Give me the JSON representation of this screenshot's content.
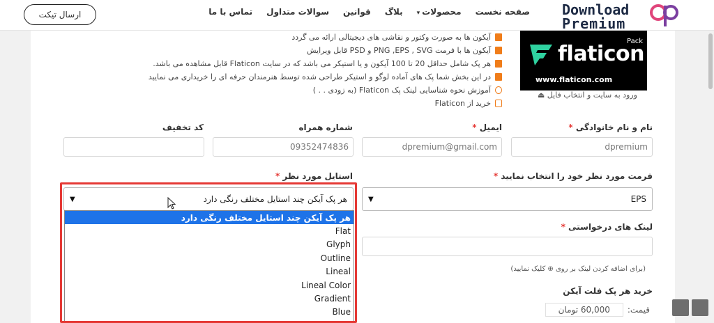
{
  "header": {
    "ticket_button": "ارسال تیکت",
    "nav": [
      "صفحه نخست",
      "محصولات",
      "بلاگ",
      "قوانین",
      "سوالات متداول",
      "تماس با ما"
    ],
    "logo_line1": "Download",
    "logo_line2": "Premium"
  },
  "product": {
    "brand": "flaticon",
    "pack": "Pack",
    "url": "www.flaticon.com",
    "login_link": "ورود به سایت و انتخاب فایل"
  },
  "features": [
    "آیکون ها به صورت وکتور و نقاشی های دیجیتالی ارائه می گردد",
    "آیکون ها با فرمت PNG ,EPS , SVG و PSD قابل ویرایش",
    "هر پک شامل حداقل 20 تا 100 آیکون و یا استیکر می باشد که در سایت Flaticon قابل مشاهده می باشد.",
    "در این بخش شما پک های آماده لوگو و استیکر طراحی شده توسط هنرمندان حرفه ای را خریداری می نمایید",
    "آموزش نحوه شناسایی لینک پک Flaticon (به زودی . . )",
    "خرید از Flaticon"
  ],
  "form": {
    "name_label": "نام و نام خانوادگی",
    "name_value": "dpremium",
    "email_label": "ایمیل",
    "email_value": "dpremium@gmail.com",
    "phone_label": "شماره همراه",
    "phone_value": "09352474836",
    "discount_label": "کد تخفیف",
    "format_label": "فرمت مورد نظر خود را انتخاب نمایید",
    "format_value": "EPS",
    "style_label": "استایل مورد نظر",
    "style_value": "هر پک آیکن چند استایل مختلف رنگی دارد",
    "style_options": [
      "هر پک آیکن چند استایل مختلف رنگی دارد",
      "Flat",
      "Glyph",
      "Outline",
      "Lineal",
      "Lineal Color",
      "Gradient",
      "Blue"
    ],
    "link_label": "لینک های درخواستی",
    "link_hint": "(برای اضافه کردن لینک بر روی ⊕ کلیک نمایید)",
    "buy_title": "خرید هر پک فلت آیکن",
    "price_label": "قیمت:",
    "price_value": "60,000 تومان"
  },
  "colors": {
    "highlight": "#e53935",
    "selected_option": "#1e73e8",
    "icon_orange": "#f07d1a",
    "logo_pink": "#e0457b",
    "logo_navy": "#1d2a44"
  }
}
